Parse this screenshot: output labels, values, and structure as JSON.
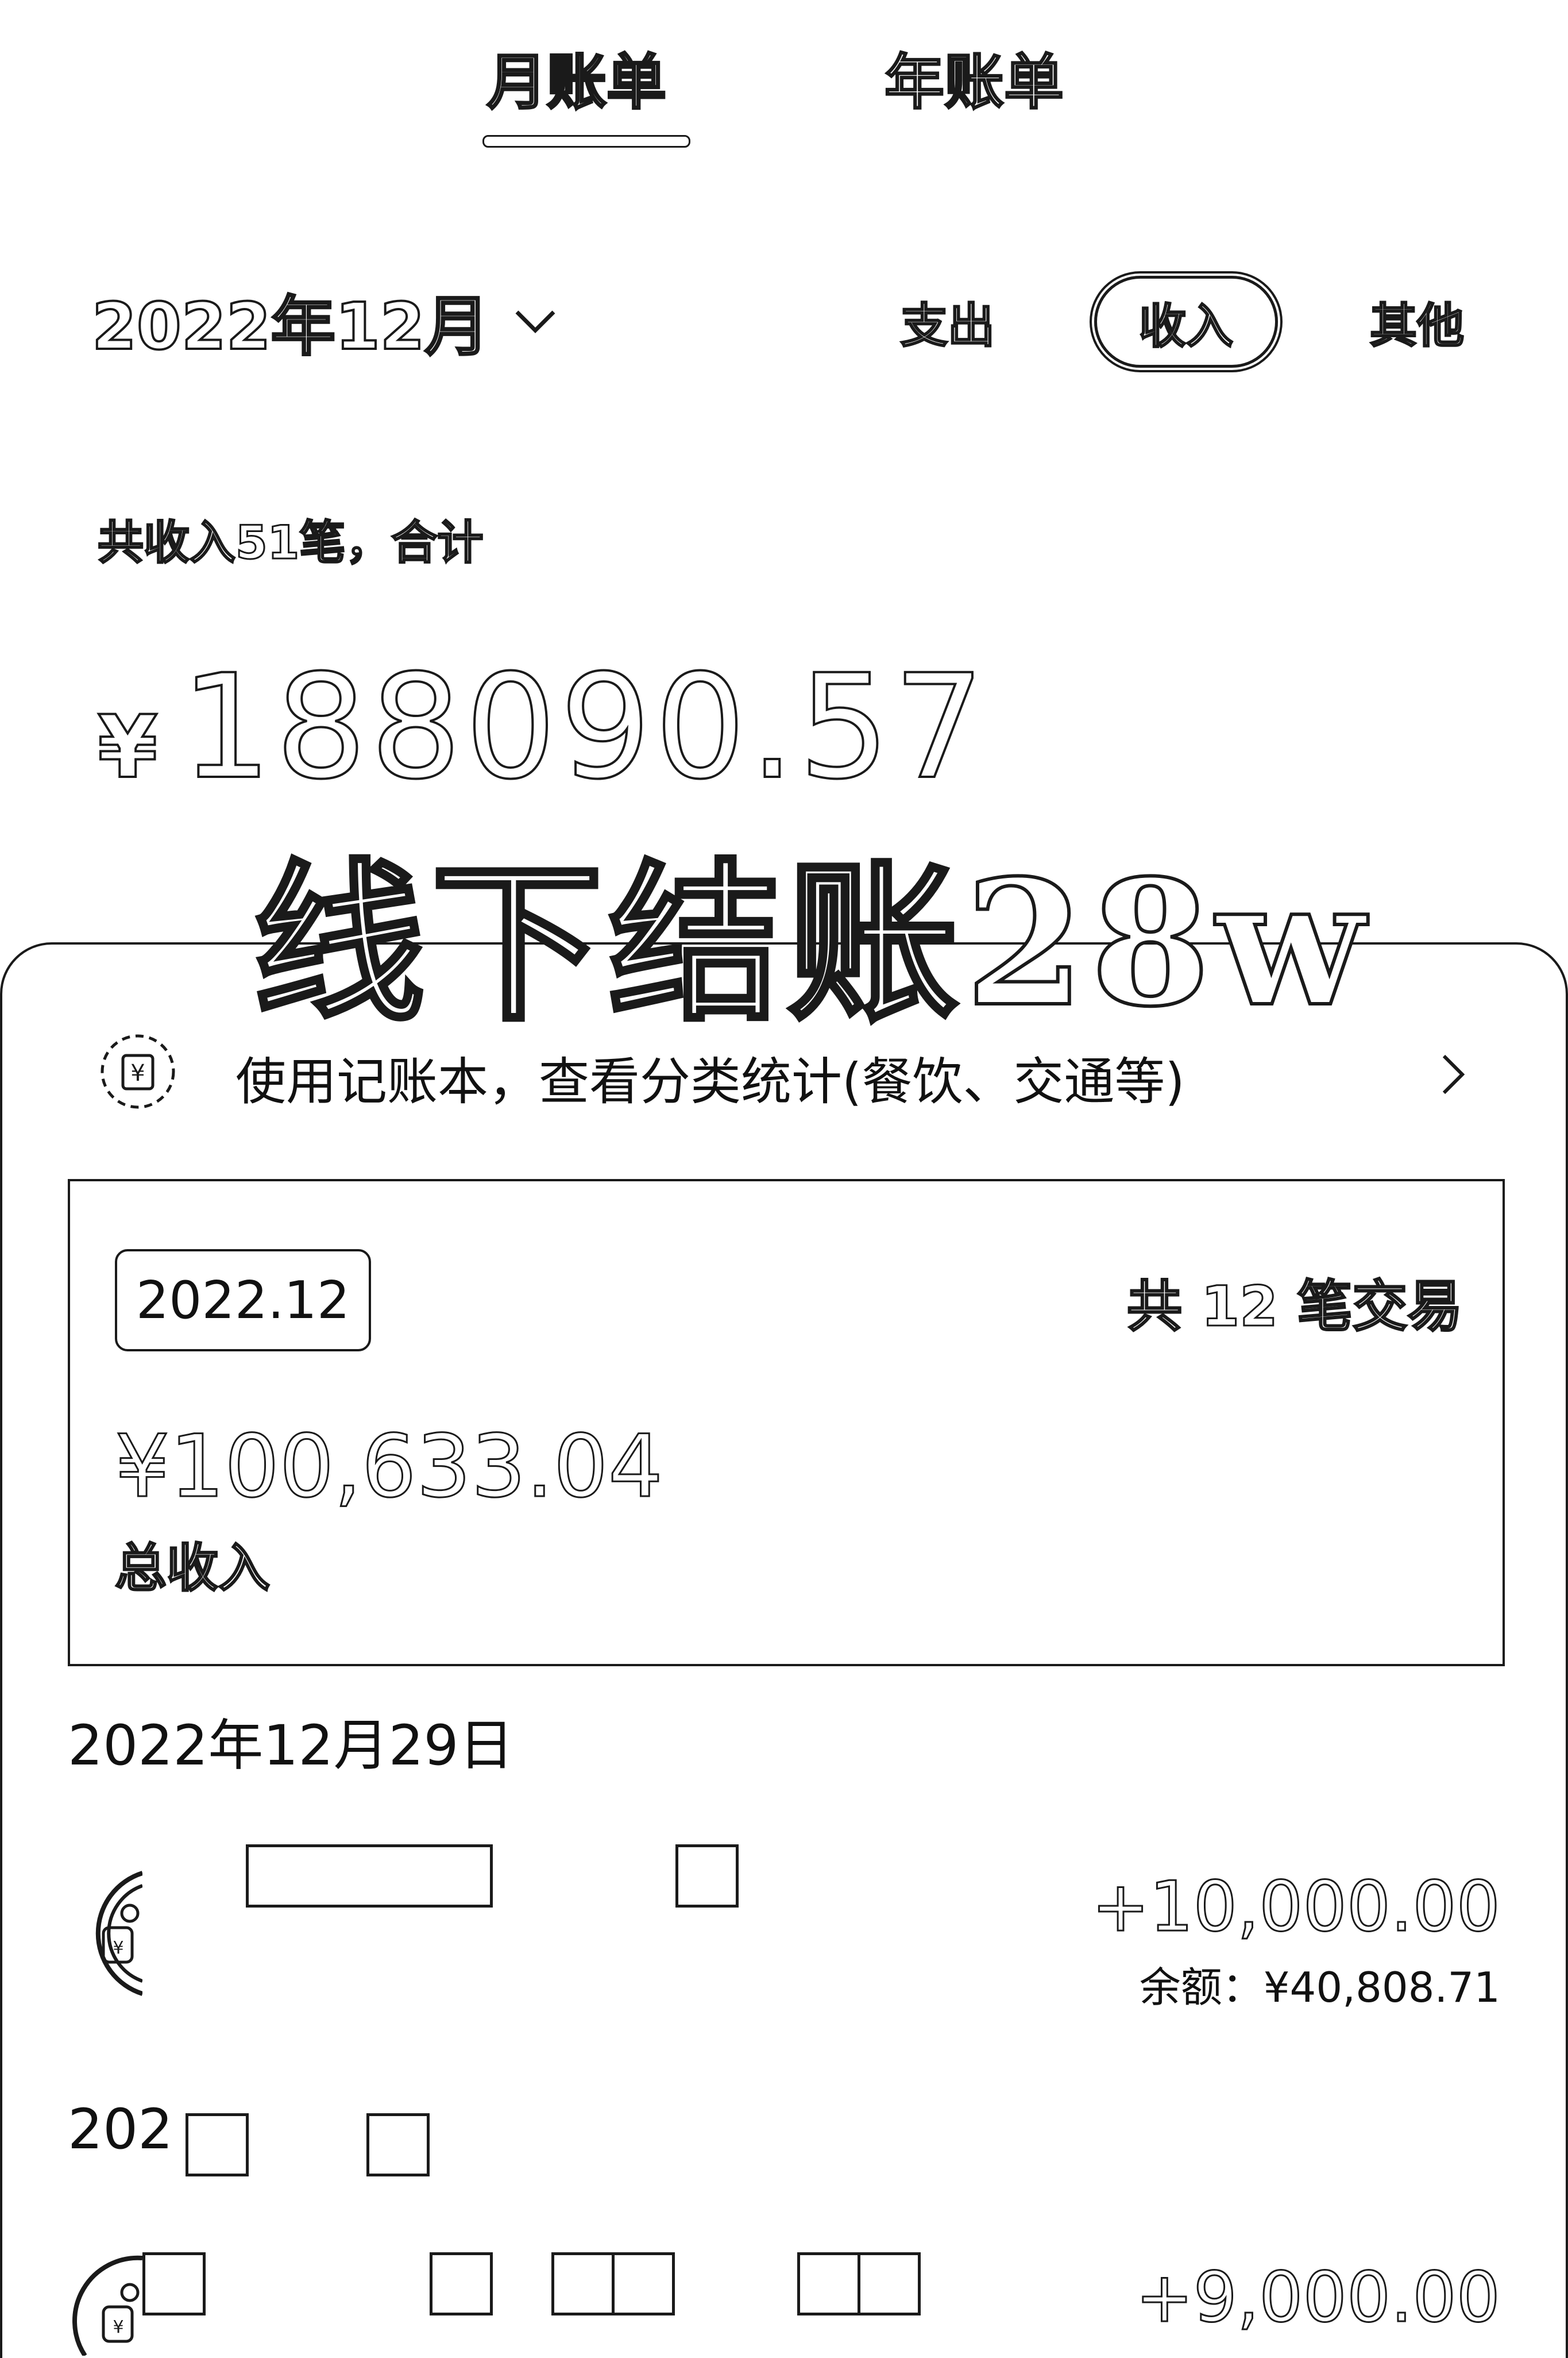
{
  "tabs": {
    "monthly": "月账单",
    "yearly": "年账单"
  },
  "filter": {
    "month": "2022年12月",
    "segments": [
      "支出",
      "收入",
      "其他"
    ],
    "selected": "收入"
  },
  "summary": {
    "caption": "共收入51笔，合计",
    "currency": "¥",
    "amount": "188090.57"
  },
  "watermark": "线下结账28w",
  "banner": {
    "text": "使用记账本，查看分类统计(餐饮、交通等)"
  },
  "card": {
    "period": "2022.12",
    "count": "共 12 笔交易",
    "amount": "¥100,633.04",
    "label": "总收入"
  },
  "day1": {
    "date": "2022年12月29日",
    "transaction": {
      "amount": "+10,000.00",
      "balance": "余额：¥40,808.71"
    }
  },
  "day2": {
    "date_partial": "202",
    "transaction": {
      "amount": "+9,000.00"
    }
  },
  "colors": {
    "ink": "#1a1a1a",
    "background": "#ffffff"
  }
}
